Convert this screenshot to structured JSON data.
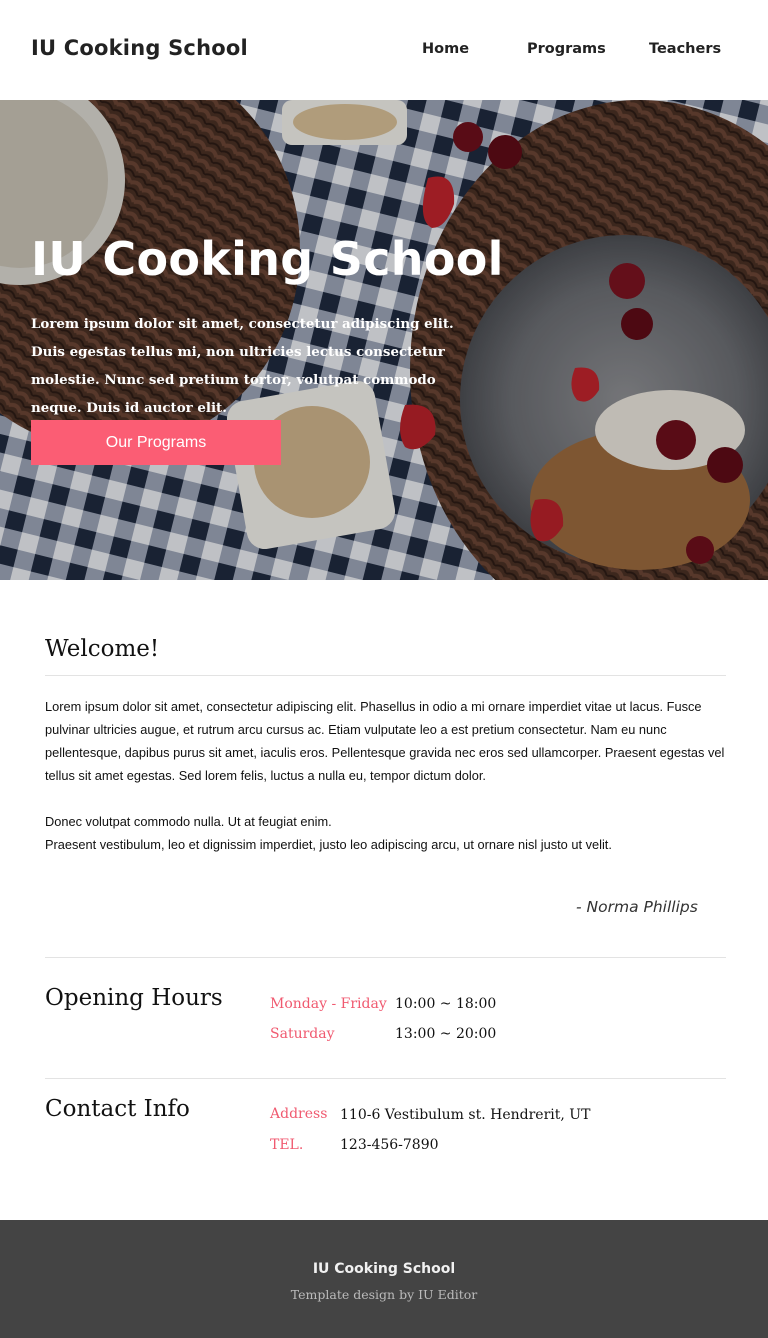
{
  "header": {
    "logo": "IU Cooking School",
    "nav": [
      "Home",
      "Programs",
      "Teachers"
    ]
  },
  "hero": {
    "title": "IU Cooking School",
    "text": "Lorem ipsum dolor sit amet, consectetur adipiscing elit. Duis egestas tellus mi, non ultricies lectus consectetur molestie. Nunc sed pretium tortor, volutpat commodo neque. Duis id auctor elit.",
    "button": "Our Programs"
  },
  "welcome": {
    "title": "Welcome!",
    "paragraph1": "Lorem ipsum dolor sit amet, consectetur adipiscing elit. Phasellus in odio a mi ornare imperdiet vitae ut lacus. Fusce pulvinar ultricies augue, et rutrum arcu cursus ac. Etiam vulputate leo a est pretium consectetur. Nam eu nunc pellentesque, dapibus purus sit amet, iaculis eros. Pellentesque gravida nec eros sed ullamcorper. Praesent egestas vel tellus sit amet egestas. Sed lorem felis, luctus a nulla eu, tempor dictum dolor.",
    "paragraph2_line1": "Donec volutpat commodo nulla. Ut at feugiat enim.",
    "paragraph2_line2": "Praesent vestibulum, leo et dignissim imperdiet, justo leo adipiscing arcu, ut ornare nisl justo ut velit.",
    "signature": "- Norma Phillips"
  },
  "hours": {
    "title": "Opening Hours",
    "rows": [
      {
        "label": "Monday - Friday",
        "value": "10:00 ~ 18:00"
      },
      {
        "label": "Saturday",
        "value": "13:00 ~ 20:00"
      }
    ]
  },
  "contact": {
    "title": "Contact Info",
    "rows": [
      {
        "label": "Address",
        "value": "110-6 Vestibulum st. Hendrerit, UT"
      },
      {
        "label": "TEL.",
        "value": "123-456-7890"
      }
    ]
  },
  "footer": {
    "title": "IU Cooking School",
    "subtitle": "Template design by IU Editor"
  },
  "colors": {
    "accent": "#fb5d74",
    "label": "#f05a70",
    "footer_bg": "#444444"
  }
}
